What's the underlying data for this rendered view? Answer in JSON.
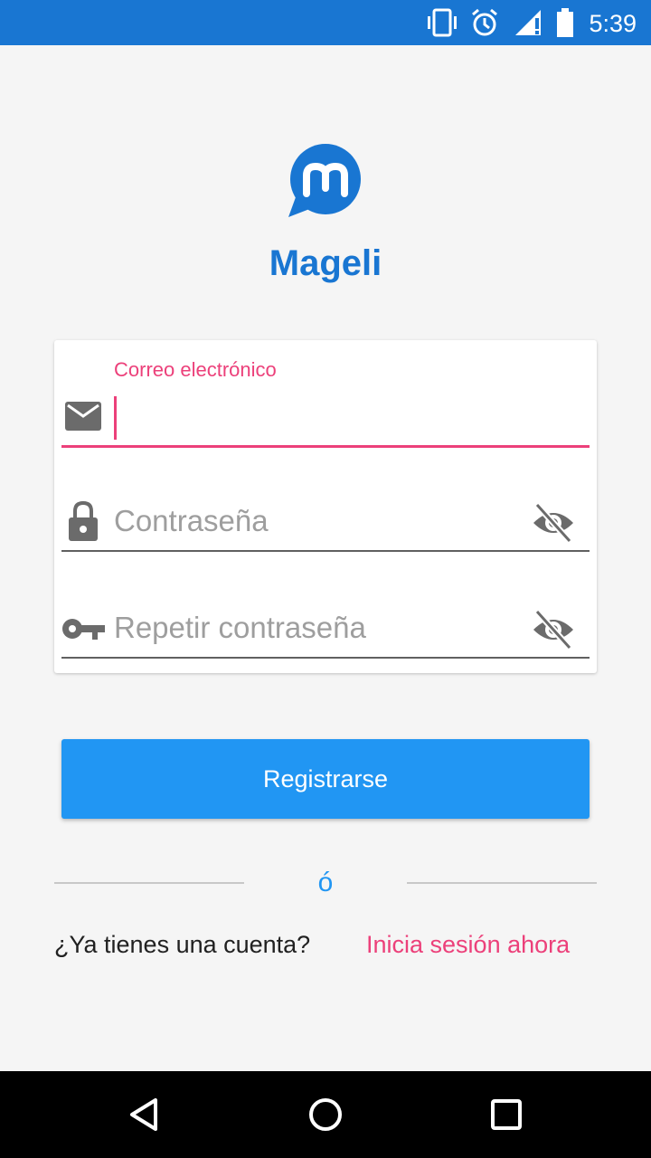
{
  "status_bar": {
    "time": "5:39",
    "icons": [
      "vibrate-icon",
      "alarm-icon",
      "signal-icon",
      "battery-icon"
    ],
    "color": "#1976d2"
  },
  "app": {
    "name": "Mageli",
    "logo_letter": "m",
    "brand_color": "#1976d2"
  },
  "form": {
    "email": {
      "label": "Correo electrónico",
      "value": "",
      "icon": "mail-icon"
    },
    "password": {
      "placeholder": "Contraseña",
      "icon": "lock-icon",
      "toggle_icon": "visibility-off-icon"
    },
    "repeat_password": {
      "placeholder": "Repetir contraseña",
      "icon": "key-icon",
      "toggle_icon": "visibility-off-icon"
    },
    "accent_color": "#ec407a"
  },
  "register_button": {
    "label": "Registrarse",
    "color": "#2196f3"
  },
  "divider": {
    "text": "ó"
  },
  "login_prompt": {
    "question": "¿Ya tienes una cuenta?",
    "link": "Inicia sesión ahora"
  },
  "nav_bar": {
    "buttons": [
      "back-icon",
      "home-icon",
      "recents-icon"
    ]
  }
}
